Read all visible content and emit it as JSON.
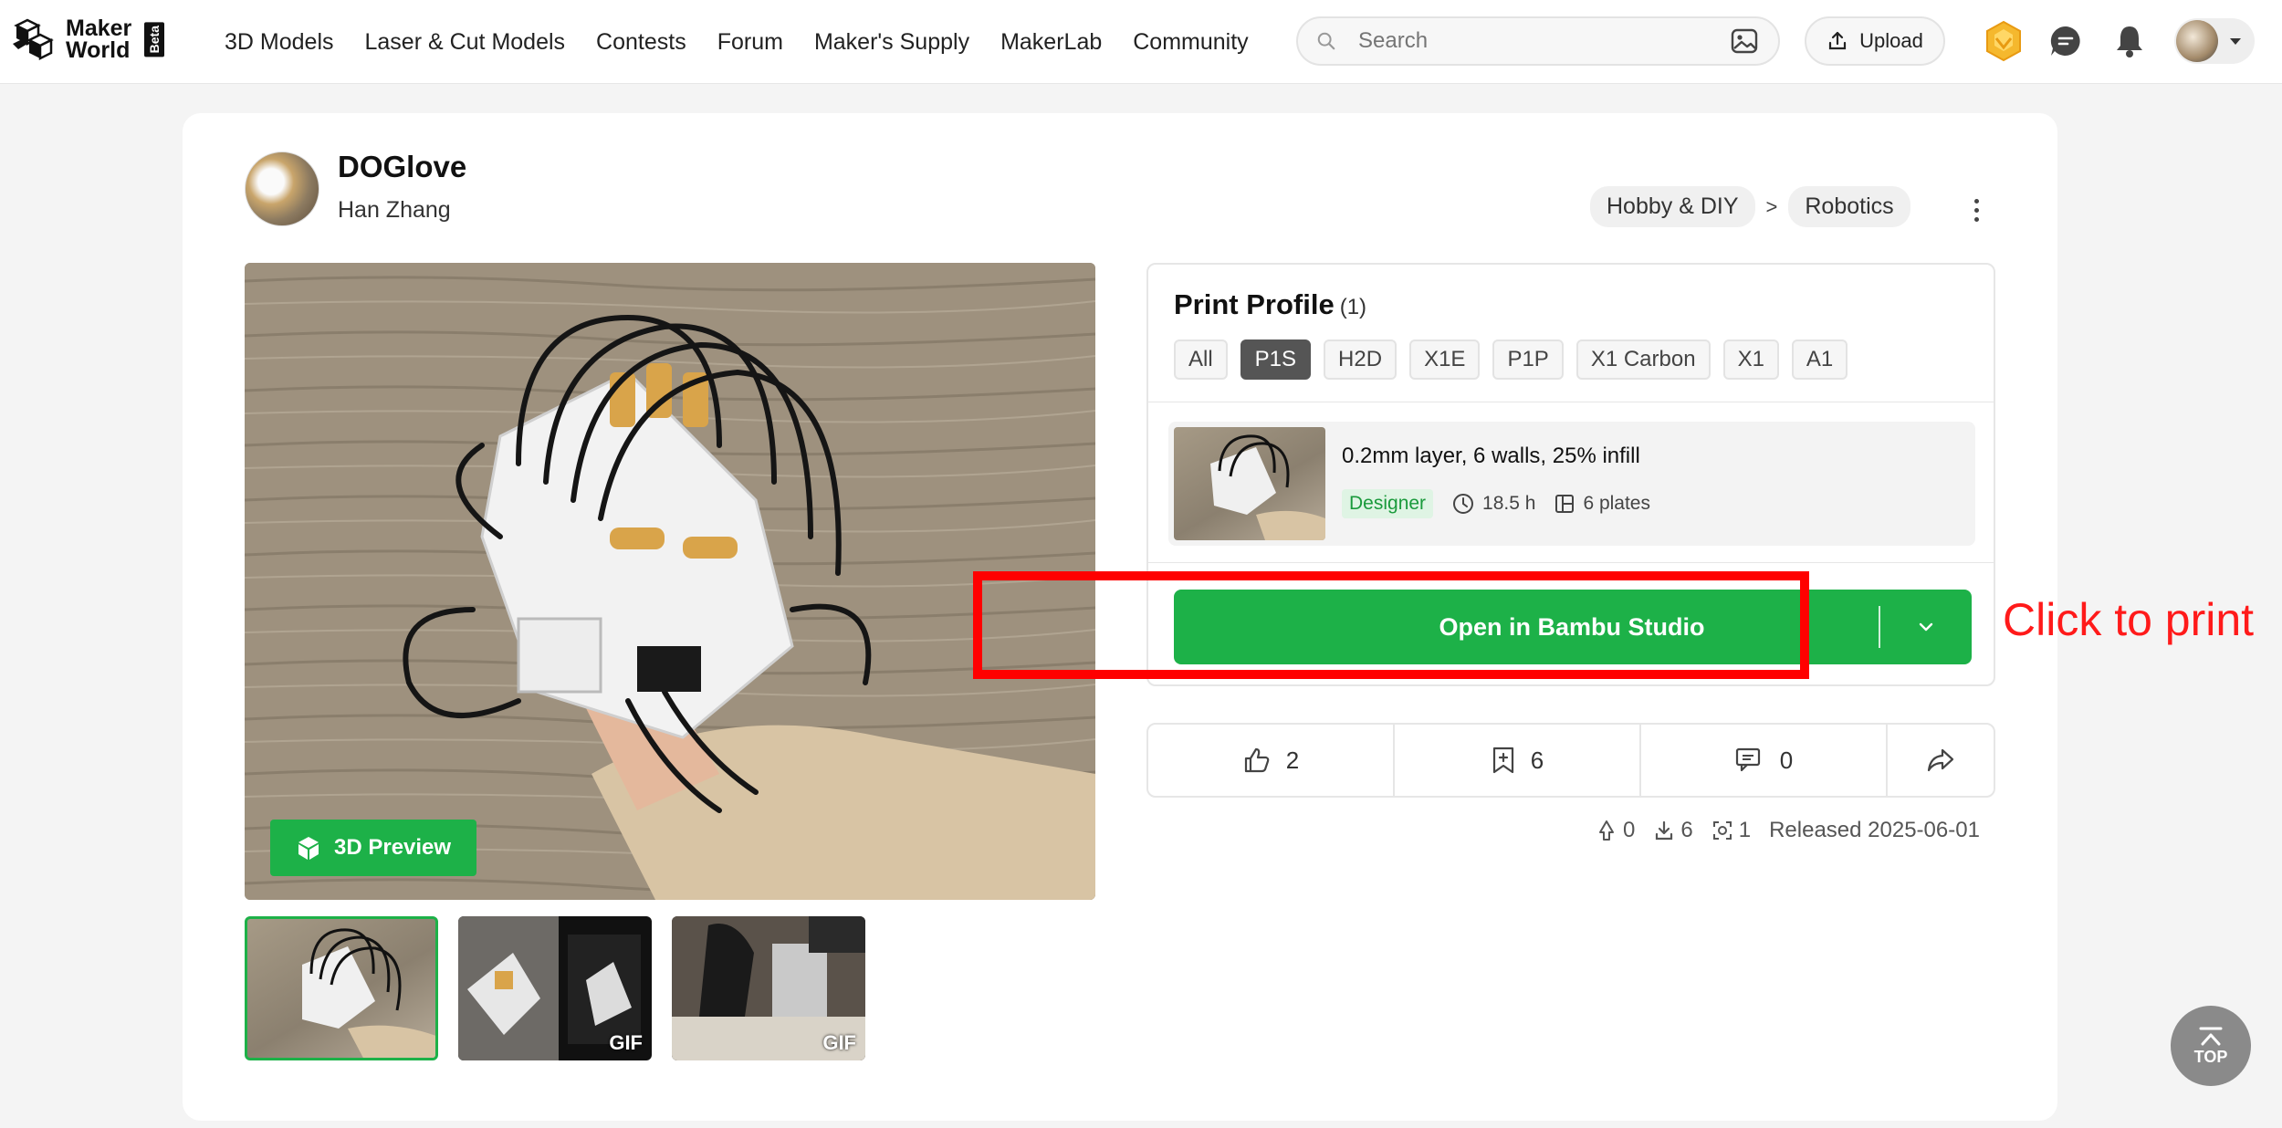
{
  "header": {
    "logo_line1": "Maker",
    "logo_line2": "World",
    "beta": "Beta",
    "nav": [
      "3D Models",
      "Laser & Cut Models",
      "Contests",
      "Forum",
      "Maker's Supply",
      "MakerLab",
      "Community"
    ],
    "search_placeholder": "Search",
    "upload_label": "Upload"
  },
  "model": {
    "title": "DOGlove",
    "author": "Han Zhang",
    "breadcrumb": [
      "Hobby & DIY",
      "Robotics"
    ],
    "breadcrumb_sep": ">",
    "preview_label": "3D Preview",
    "thumbnails": [
      {
        "badge": ""
      },
      {
        "badge": "GIF"
      },
      {
        "badge": "GIF"
      }
    ]
  },
  "print_profile": {
    "title": "Print Profile",
    "count": "(1)",
    "filters": [
      "All",
      "P1S",
      "H2D",
      "X1E",
      "P1P",
      "X1 Carbon",
      "X1",
      "A1"
    ],
    "selected_filter": "P1S",
    "plate": {
      "name": "0.2mm layer, 6 walls, 25% infill",
      "badge": "Designer",
      "time": "18.5 h",
      "plates": "6 plates"
    },
    "open_button": "Open in Bambu Studio"
  },
  "annotation": "Click to print",
  "stats": {
    "likes": "2",
    "collects": "6",
    "comments": "0"
  },
  "footer": {
    "boosts": "0",
    "downloads": "6",
    "prints": "1",
    "released": "Released 2025-06-01"
  },
  "top_button": "TOP",
  "colors": {
    "accent": "#1db148",
    "annotation": "#ff0000"
  }
}
